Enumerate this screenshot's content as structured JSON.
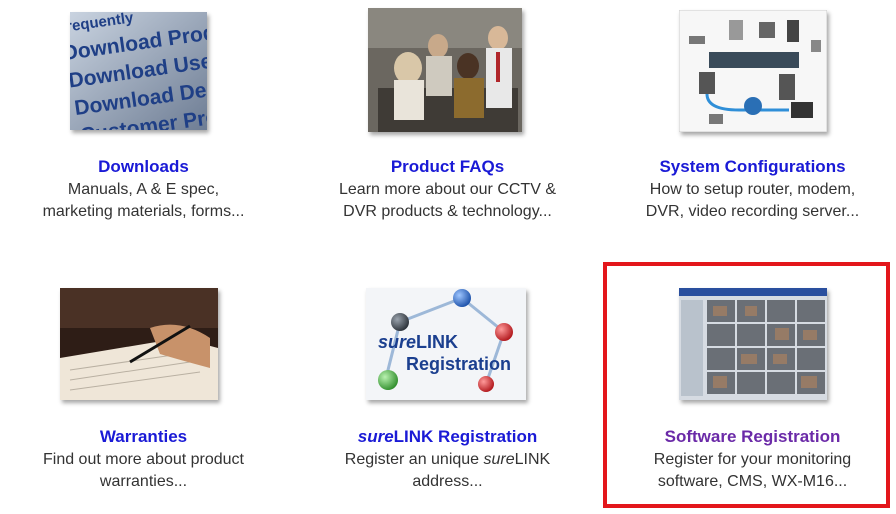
{
  "tiles": [
    {
      "id": "downloads",
      "title": "Downloads",
      "desc_line1": "Manuals, A & E spec,",
      "desc_line2": "marketing materials, forms...",
      "image_text": [
        "Frequently",
        "Download Produ",
        "Download User",
        "Download Demo",
        "Customer Profi"
      ]
    },
    {
      "id": "product-faqs",
      "title": "Product FAQs",
      "desc_line1": "Learn more about our CCTV &",
      "desc_line2": "DVR products & technology..."
    },
    {
      "id": "system-configurations",
      "title": "System Configurations",
      "desc_line1": "How to setup router, modem,",
      "desc_line2": "DVR, video recording server..."
    },
    {
      "id": "warranties",
      "title": "Warranties",
      "desc_line1": "Find out more about product",
      "desc_line2": "warranties..."
    },
    {
      "id": "surelink-registration",
      "title_italic": "sure",
      "title_rest": "LINK Registration",
      "desc_line1_pre": "Register an unique ",
      "desc_line1_italic": "sure",
      "desc_line1_post": "LINK",
      "desc_line2": "address...",
      "image_text_italic": "sure",
      "image_text_rest": "LINK",
      "image_text_line2": "Registration"
    },
    {
      "id": "software-registration",
      "title": "Software Registration",
      "desc_line1": "Register for your monitoring",
      "desc_line2": "software, CMS, WX-M16...",
      "highlighted": true
    }
  ],
  "colors": {
    "link": "#1a1ad6",
    "visited_link": "#6b2aa8",
    "highlight_border": "#e3161b",
    "body_text": "#333333"
  }
}
